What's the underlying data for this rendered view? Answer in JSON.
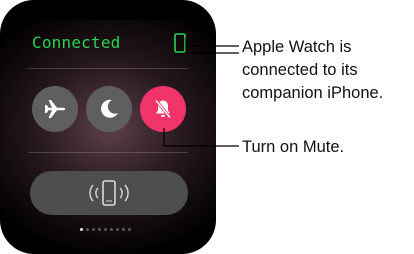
{
  "status": {
    "text": "Connected",
    "text_color": "#2ed150",
    "icon": "iphone-connected-icon"
  },
  "controls": [
    {
      "name": "airplane-mode",
      "icon": "airplane-icon",
      "state": "off"
    },
    {
      "name": "do-not-disturb",
      "icon": "moon-icon",
      "state": "off"
    },
    {
      "name": "mute",
      "icon": "bell-slash-icon",
      "state": "on",
      "color": "#f1356a"
    }
  ],
  "ping_button": {
    "icon": "ping-iphone-icon"
  },
  "page_indicator": {
    "count": 9,
    "active": 1
  },
  "callouts": {
    "connected": "Apple Watch is\nconnected to its\ncompanion iPhone.",
    "mute": "Turn on Mute."
  }
}
